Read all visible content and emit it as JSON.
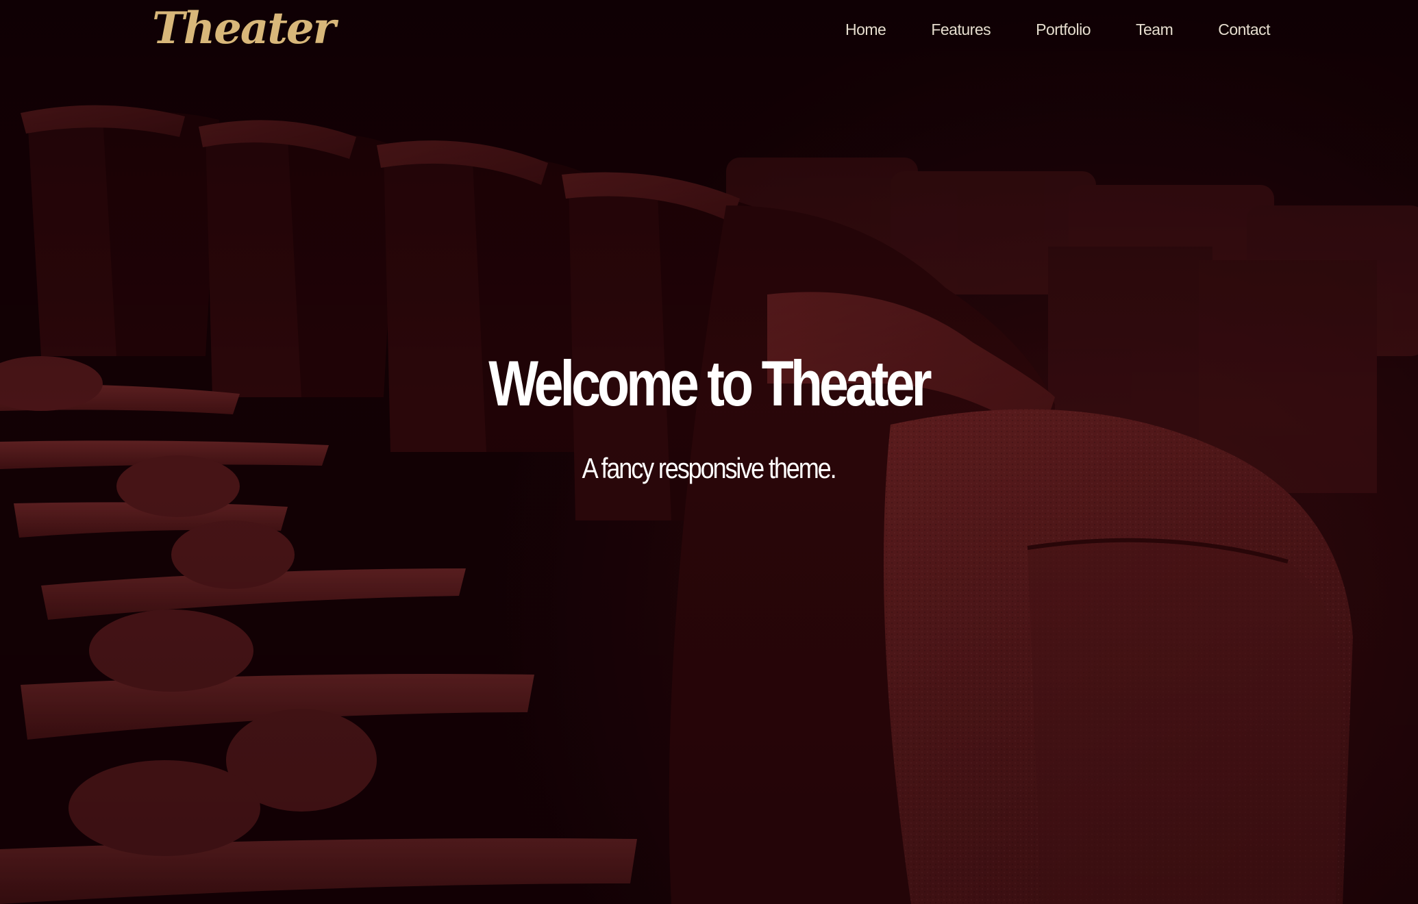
{
  "brand": {
    "logo_text": "Theater",
    "logo_color": "#d8b77a"
  },
  "nav": {
    "items": [
      {
        "label": "Home"
      },
      {
        "label": "Features"
      },
      {
        "label": "Portfolio"
      },
      {
        "label": "Team"
      },
      {
        "label": "Contact"
      }
    ]
  },
  "hero": {
    "title": "Welcome to Theater",
    "subtitle": "A fancy responsive theme.",
    "background_image": "theater-seats-photo"
  },
  "colors": {
    "background_dark": "#120105",
    "seat_red": "#7a2526",
    "text": "#ffffff",
    "nav_text": "#e6ddcf"
  }
}
